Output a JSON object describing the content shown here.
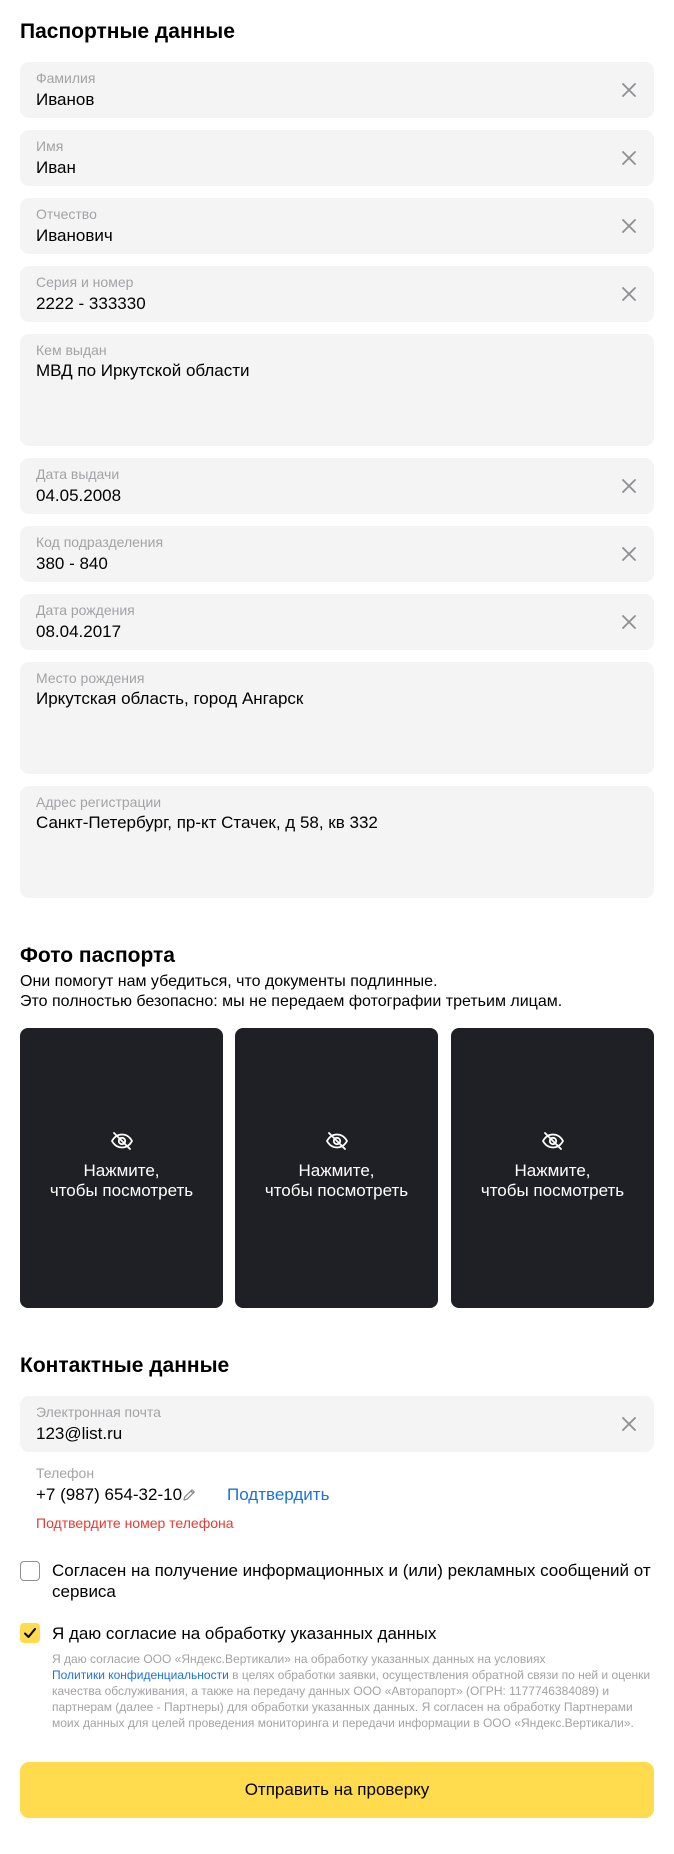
{
  "passport": {
    "title": "Паспортные данные",
    "fields": [
      {
        "label": "Фамилия",
        "value": "Иванов"
      },
      {
        "label": "Имя",
        "value": "Иван"
      },
      {
        "label": "Отчество",
        "value": "Иванович"
      },
      {
        "label": "Серия и номер",
        "value": "2222 - 333330"
      },
      {
        "label": "Кем выдан",
        "value": "МВД по Иркутской области"
      },
      {
        "label": "Дата выдачи",
        "value": "04.05.2008"
      },
      {
        "label": "Код подразделения",
        "value": "380 - 840"
      },
      {
        "label": "Дата рождения",
        "value": "08.04.2017"
      },
      {
        "label": "Место рождения",
        "value": "Иркутская область, город Ангарск"
      },
      {
        "label": "Адрес регистрации",
        "value": "Санкт-Петербург, пр-кт Стачек, д 58, кв 332"
      }
    ]
  },
  "photos": {
    "title": "Фото паспорта",
    "desc_line1": "Они помогут нам убедиться, что документы подлинные.",
    "desc_line2": "Это полностью безопасно: мы не передаем фотографии третьим лицам.",
    "tile_line1": "Нажмите,",
    "tile_line2": "чтобы посмотреть",
    "icon": "eye-off-icon"
  },
  "contacts": {
    "title": "Контактные данные",
    "email_label": "Электронная почта",
    "email_value": "123@list.ru",
    "phone_label": "Телефон",
    "phone_value": "+7 (987) 654-32-10",
    "confirm_label": "Подтвердить",
    "error_text": "Подтвердите номер телефона"
  },
  "consents": {
    "marketing_line1": "Согласен на получение информационных и (или) рекламных сообщений от",
    "marketing_line2": "сервиса",
    "marketing_checked": false,
    "data_processing": "Я даю согласие на обработку указанных данных",
    "data_processing_checked": true,
    "legal_1": "Я даю согласие ООО «Яндекс.Вертикали» на обработку указанных данных на условиях",
    "legal_link": "Политики конфиденциальности",
    "legal_2": " в целях обработки заявки, осуществления обратной связи по ней и оценки качества обслуживания, а также на передачу данных ООО «Авторапорт» (ОГРН: 1177746384089) и партнерам (далее - Партнеры) для обработки указанных данных. Я согласен на обработку Партнерами моих данных для целей проведения мониторинга и передачи информации в ООО «Яндекс.Вертикали»."
  },
  "submit_label": "Отправить на проверку",
  "colors": {
    "accent": "#ffdb4d",
    "link": "#1a73d9",
    "error": "#e63b33",
    "field_bg": "#f4f4f5",
    "photo_bg": "#1f1f26"
  }
}
